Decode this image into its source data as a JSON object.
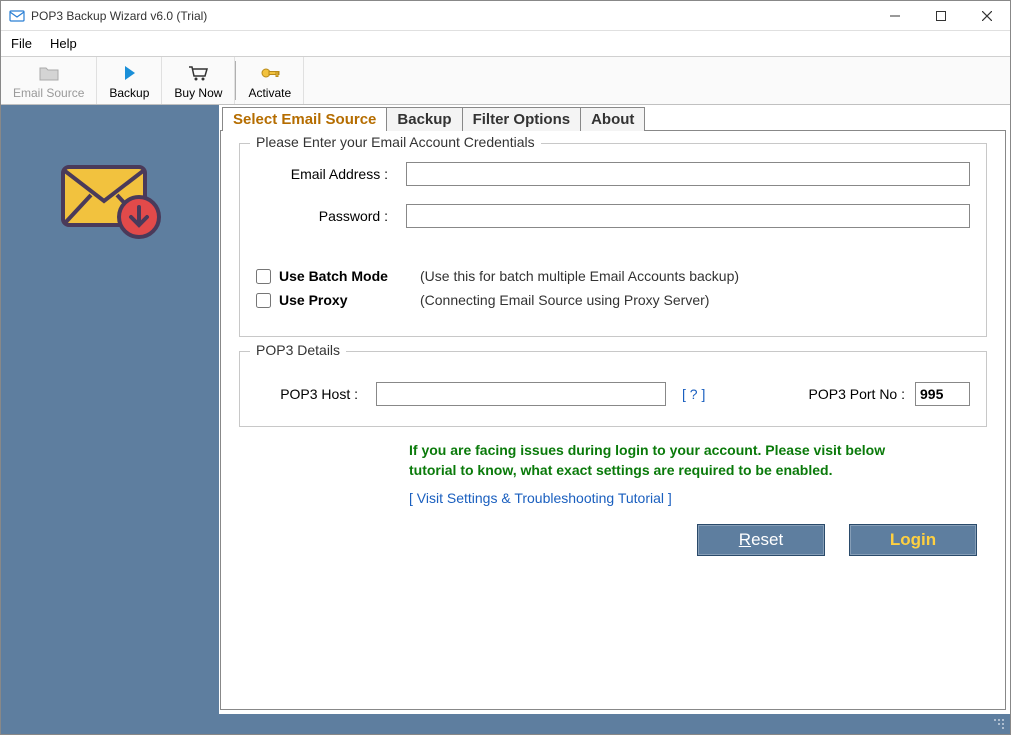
{
  "window": {
    "title": "POP3 Backup Wizard v6.0 (Trial)"
  },
  "menus": {
    "file": "File",
    "help": "Help"
  },
  "toolbar": {
    "email_source": "Email Source",
    "backup": "Backup",
    "buy_now": "Buy Now",
    "activate": "Activate"
  },
  "tabs": {
    "select_source": "Select Email Source",
    "backup": "Backup",
    "filter": "Filter Options",
    "about": "About"
  },
  "credentials": {
    "legend": "Please Enter your Email Account Credentials",
    "email_label": "Email Address :",
    "email_value": "",
    "password_label": "Password :",
    "password_value": "",
    "batch_label": "Use Batch Mode",
    "batch_hint": "(Use this for batch multiple Email Accounts backup)",
    "proxy_label": "Use Proxy",
    "proxy_hint": "(Connecting Email Source using Proxy Server)"
  },
  "pop3": {
    "legend": "POP3 Details",
    "host_label": "POP3 Host :",
    "host_value": "",
    "help_link": "[ ? ]",
    "port_label": "POP3 Port No :",
    "port_value": "995"
  },
  "info": {
    "msg": "If you are facing issues during login to your account. Please visit below tutorial to know, what exact settings are required to be enabled.",
    "tutorial": "[ Visit Settings & Troubleshooting Tutorial ]"
  },
  "buttons": {
    "reset": "Reset",
    "login": "Login"
  }
}
